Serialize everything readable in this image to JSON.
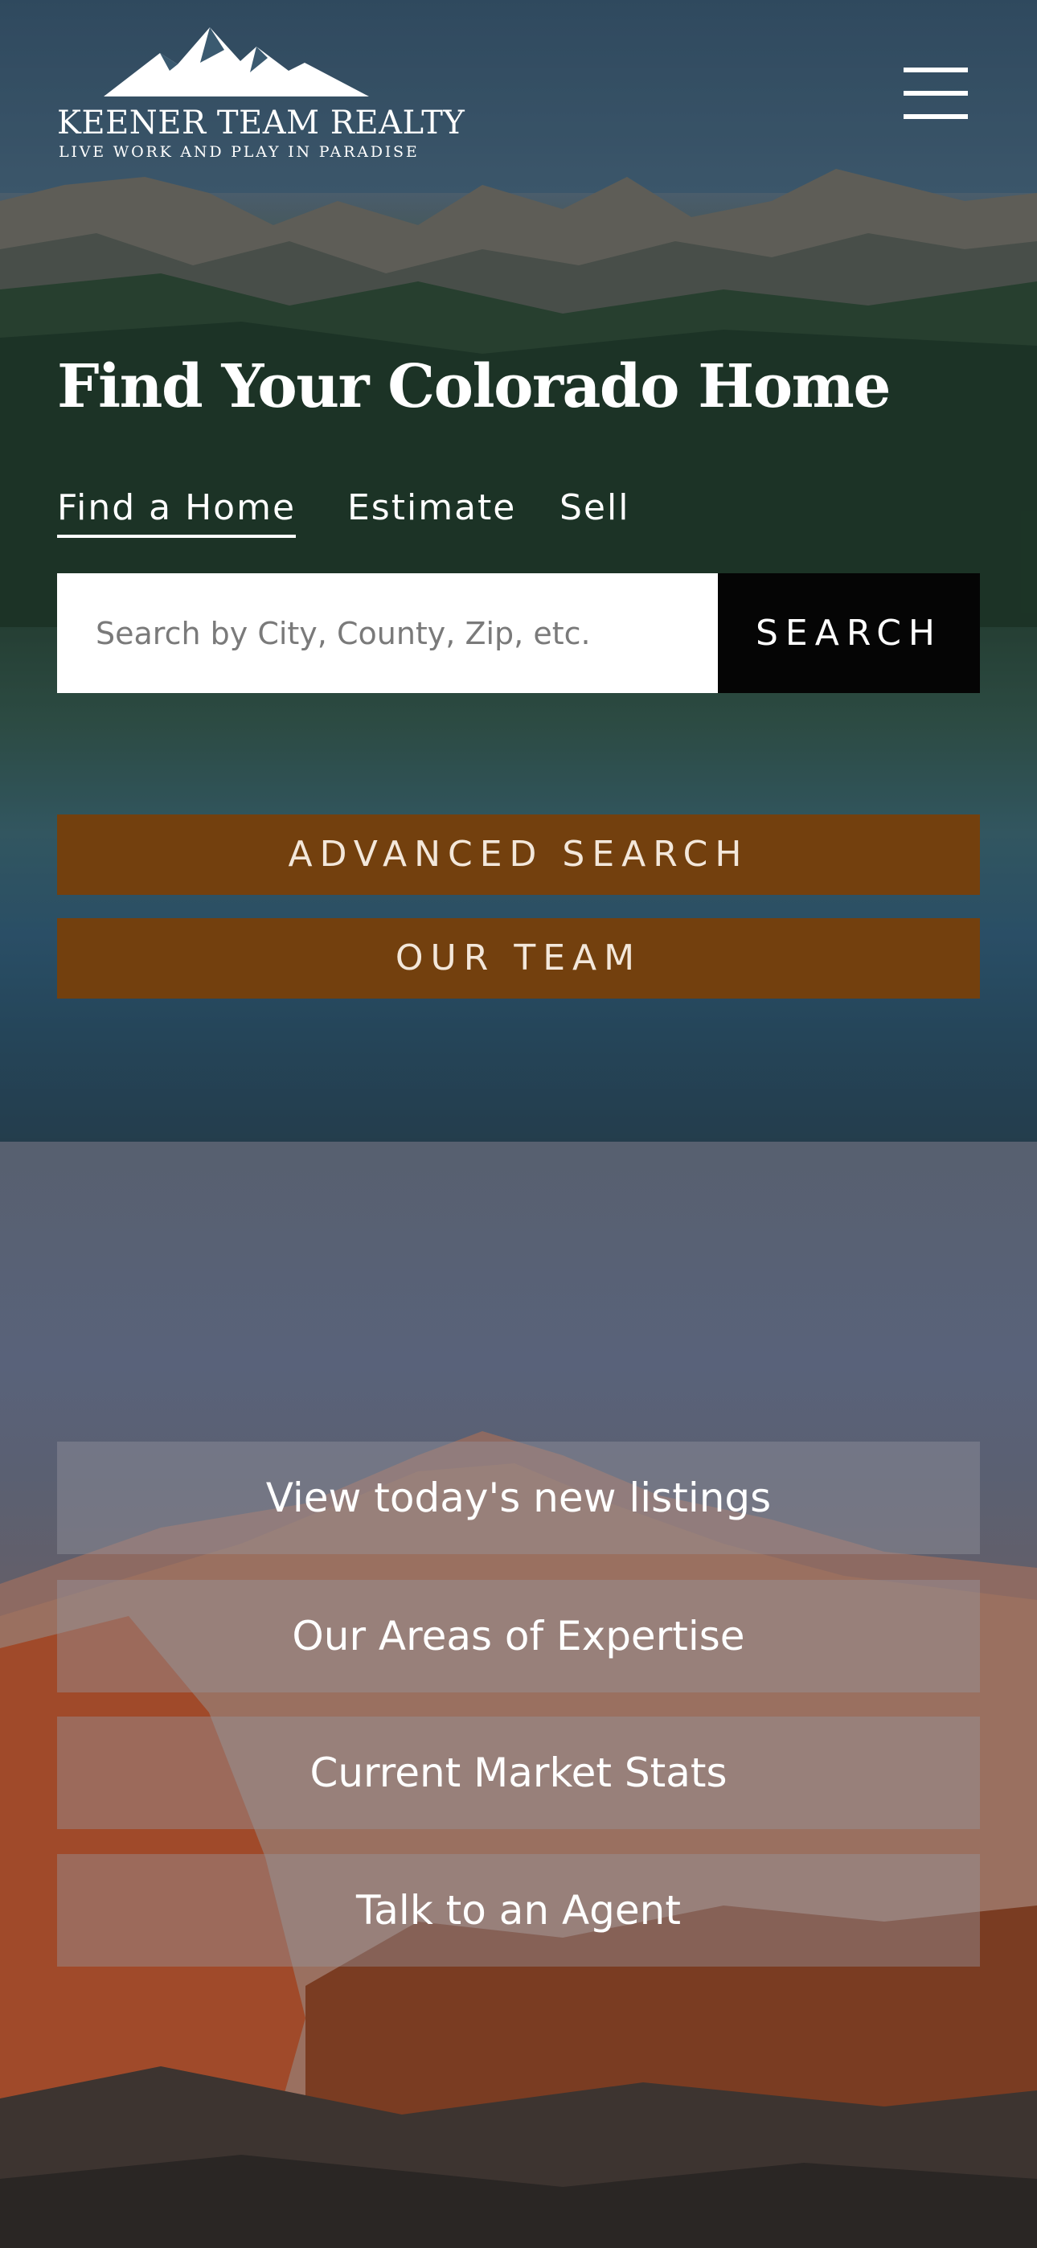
{
  "brand": {
    "name": "KEENER TEAM REALTY",
    "tagline": "LIVE WORK AND PLAY IN PARADISE"
  },
  "hero": {
    "title": "Find Your Colorado Home",
    "tabs": [
      {
        "label": "Find a Home",
        "active": true
      },
      {
        "label": "Estimate",
        "active": false
      },
      {
        "label": "Sell",
        "active": false
      }
    ],
    "search": {
      "placeholder": "Search by City, County, Zip, etc.",
      "value": "",
      "button_label": "SEARCH"
    },
    "advanced_search_label": "ADVANCED SEARCH",
    "our_team_label": "OUR TEAM"
  },
  "quick_links": [
    {
      "label": "View today's new listings"
    },
    {
      "label": "Our Areas of Expertise"
    },
    {
      "label": "Current Market Stats"
    },
    {
      "label": "Talk to an Agent"
    }
  ],
  "colors": {
    "accent_brown": "#73400e",
    "search_button": "#050505"
  },
  "icons": {
    "menu": "hamburger-menu-icon",
    "logo": "mountain-logo-icon"
  }
}
